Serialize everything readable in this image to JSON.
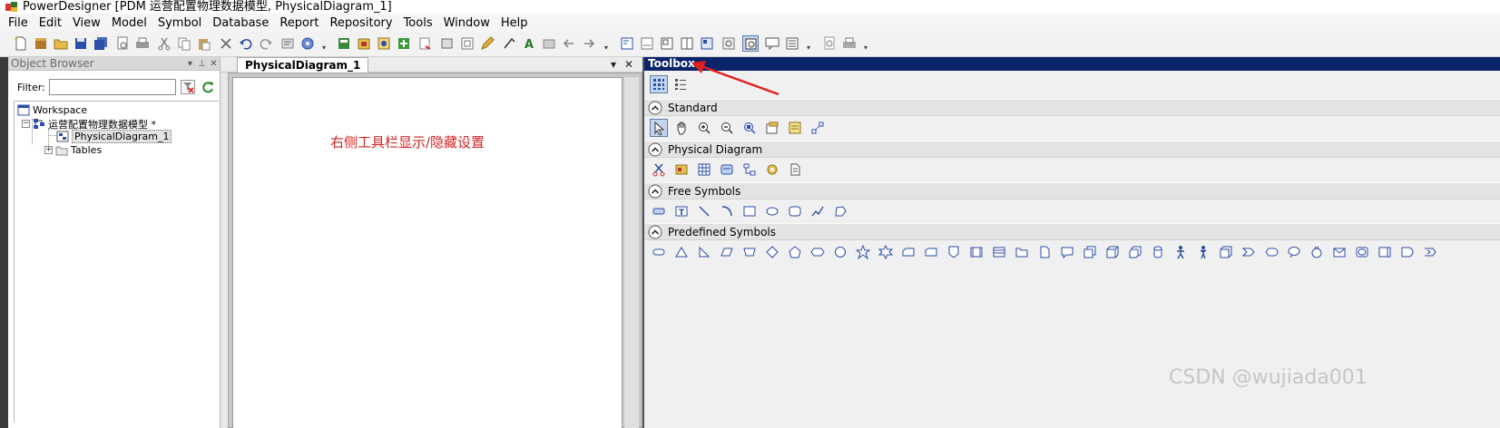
{
  "title_bar": {
    "title": "PowerDesigner [PDM 运营配置物理数据模型, PhysicalDiagram_1]"
  },
  "menu": {
    "items": [
      "File",
      "Edit",
      "View",
      "Model",
      "Symbol",
      "Database",
      "Report",
      "Repository",
      "Tools",
      "Window",
      "Help"
    ]
  },
  "object_browser": {
    "title": "Object Browser",
    "filter_label": "Filter:",
    "filter_value": "",
    "tree": {
      "workspace": "Workspace",
      "model": "运营配置物理数据模型 *",
      "diagram": "PhysicalDiagram_1",
      "tables": "Tables"
    }
  },
  "diagram": {
    "tab_label": "PhysicalDiagram_1",
    "annotation": "右侧工具栏显示/隐藏设置"
  },
  "toolbox": {
    "title": "Toolbox",
    "sections": [
      {
        "label": "Standard"
      },
      {
        "label": "Physical Diagram"
      },
      {
        "label": "Free Symbols"
      },
      {
        "label": "Predefined Symbols"
      }
    ]
  },
  "colors": {
    "toolbox_header": "#0a246a",
    "annotation": "#d42424",
    "selection": "#c3d5ee"
  },
  "watermark": "CSDN @wujiada001"
}
